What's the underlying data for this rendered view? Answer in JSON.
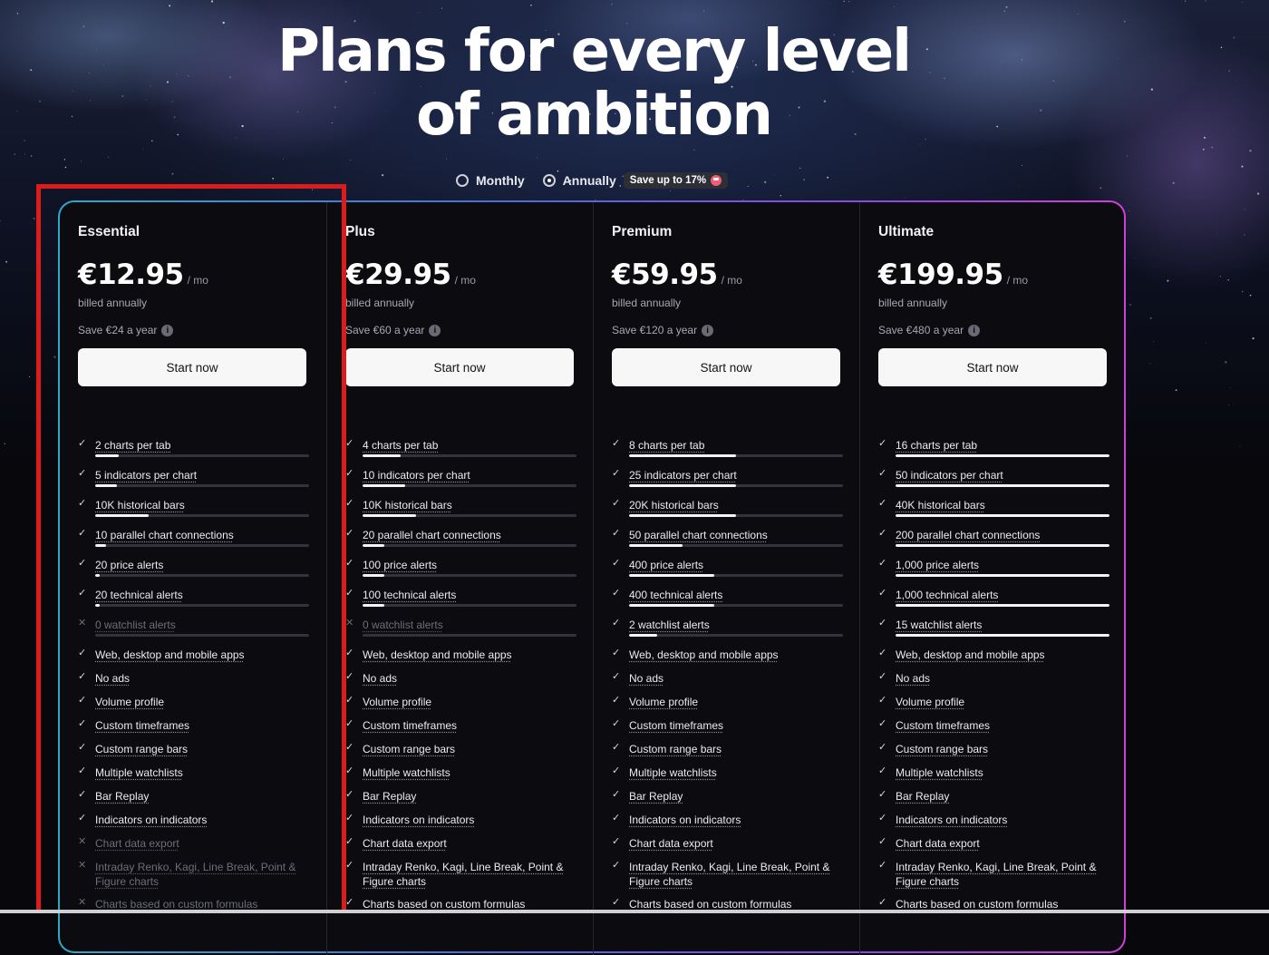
{
  "hero": {
    "title_line1": "Plans for every level",
    "title_line2": "of ambition"
  },
  "billing": {
    "monthly_label": "Monthly",
    "annually_label": "Annually",
    "selected": "Annually",
    "save_pill": "Save up to 17%"
  },
  "plans": [
    {
      "name": "Essential",
      "price": "€12.95",
      "per": "/ mo",
      "billed": "billed annually",
      "save": "Save €24 a year",
      "cta": "Start now",
      "metrics": [
        {
          "label": "2 charts per tab",
          "fraction": 0.11,
          "included": true
        },
        {
          "label": "5 indicators per chart",
          "fraction": 0.1,
          "included": true
        },
        {
          "label": "10K historical bars",
          "fraction": 0.25,
          "included": true
        },
        {
          "label": "10 parallel chart connections",
          "fraction": 0.05,
          "included": true
        },
        {
          "label": "20 price alerts",
          "fraction": 0.02,
          "included": true
        },
        {
          "label": "20 technical alerts",
          "fraction": 0.02,
          "included": true
        },
        {
          "label": "0 watchlist alerts",
          "fraction": 0,
          "included": false
        }
      ],
      "features": [
        {
          "label": "Web, desktop and mobile apps",
          "included": true
        },
        {
          "label": "No ads",
          "included": true
        },
        {
          "label": "Volume profile",
          "included": true
        },
        {
          "label": "Custom timeframes",
          "included": true
        },
        {
          "label": "Custom range bars",
          "included": true
        },
        {
          "label": "Multiple watchlists",
          "included": true
        },
        {
          "label": "Bar Replay",
          "included": true
        },
        {
          "label": "Indicators on indicators",
          "included": true
        },
        {
          "label": "Chart data export",
          "included": false
        },
        {
          "label": "Intraday Renko, Kagi, Line Break, Point & Figure charts",
          "included": false
        },
        {
          "label": "Charts based on custom formulas",
          "included": false
        }
      ]
    },
    {
      "name": "Plus",
      "price": "€29.95",
      "per": "/ mo",
      "billed": "billed annually",
      "save": "Save €60 a year",
      "cta": "Start now",
      "metrics": [
        {
          "label": "4 charts per tab",
          "fraction": 0.18,
          "included": true
        },
        {
          "label": "10 indicators per chart",
          "fraction": 0.2,
          "included": true
        },
        {
          "label": "10K historical bars",
          "fraction": 0.25,
          "included": true
        },
        {
          "label": "20 parallel chart connections",
          "fraction": 0.1,
          "included": true
        },
        {
          "label": "100 price alerts",
          "fraction": 0.1,
          "included": true
        },
        {
          "label": "100 technical alerts",
          "fraction": 0.1,
          "included": true
        },
        {
          "label": "0 watchlist alerts",
          "fraction": 0,
          "included": false
        }
      ],
      "features": [
        {
          "label": "Web, desktop and mobile apps",
          "included": true
        },
        {
          "label": "No ads",
          "included": true
        },
        {
          "label": "Volume profile",
          "included": true
        },
        {
          "label": "Custom timeframes",
          "included": true
        },
        {
          "label": "Custom range bars",
          "included": true
        },
        {
          "label": "Multiple watchlists",
          "included": true
        },
        {
          "label": "Bar Replay",
          "included": true
        },
        {
          "label": "Indicators on indicators",
          "included": true
        },
        {
          "label": "Chart data export",
          "included": true
        },
        {
          "label": "Intraday Renko, Kagi, Line Break, Point & Figure charts",
          "included": true
        },
        {
          "label": "Charts based on custom formulas",
          "included": true
        }
      ]
    },
    {
      "name": "Premium",
      "price": "€59.95",
      "per": "/ mo",
      "billed": "billed annually",
      "save": "Save €120 a year",
      "cta": "Start now",
      "metrics": [
        {
          "label": "8 charts per tab",
          "fraction": 0.5,
          "included": true
        },
        {
          "label": "25 indicators per chart",
          "fraction": 0.5,
          "included": true
        },
        {
          "label": "20K historical bars",
          "fraction": 0.5,
          "included": true
        },
        {
          "label": "50 parallel chart connections",
          "fraction": 0.25,
          "included": true
        },
        {
          "label": "400 price alerts",
          "fraction": 0.4,
          "included": true
        },
        {
          "label": "400 technical alerts",
          "fraction": 0.4,
          "included": true
        },
        {
          "label": "2 watchlist alerts",
          "fraction": 0.13,
          "included": true
        }
      ],
      "features": [
        {
          "label": "Web, desktop and mobile apps",
          "included": true
        },
        {
          "label": "No ads",
          "included": true
        },
        {
          "label": "Volume profile",
          "included": true
        },
        {
          "label": "Custom timeframes",
          "included": true
        },
        {
          "label": "Custom range bars",
          "included": true
        },
        {
          "label": "Multiple watchlists",
          "included": true
        },
        {
          "label": "Bar Replay",
          "included": true
        },
        {
          "label": "Indicators on indicators",
          "included": true
        },
        {
          "label": "Chart data export",
          "included": true
        },
        {
          "label": "Intraday Renko, Kagi, Line Break, Point & Figure charts",
          "included": true
        },
        {
          "label": "Charts based on custom formulas",
          "included": true
        }
      ]
    },
    {
      "name": "Ultimate",
      "price": "€199.95",
      "per": "/ mo",
      "billed": "billed annually",
      "save": "Save €480 a year",
      "cta": "Start now",
      "metrics": [
        {
          "label": "16 charts per tab",
          "fraction": 1,
          "included": true
        },
        {
          "label": "50 indicators per chart",
          "fraction": 1,
          "included": true
        },
        {
          "label": "40K historical bars",
          "fraction": 1,
          "included": true
        },
        {
          "label": "200 parallel chart connections",
          "fraction": 1,
          "included": true
        },
        {
          "label": "1,000 price alerts",
          "fraction": 1,
          "included": true
        },
        {
          "label": "1,000 technical alerts",
          "fraction": 1,
          "included": true
        },
        {
          "label": "15 watchlist alerts",
          "fraction": 1,
          "included": true
        }
      ],
      "features": [
        {
          "label": "Web, desktop and mobile apps",
          "included": true
        },
        {
          "label": "No ads",
          "included": true
        },
        {
          "label": "Volume profile",
          "included": true
        },
        {
          "label": "Custom timeframes",
          "included": true
        },
        {
          "label": "Custom range bars",
          "included": true
        },
        {
          "label": "Multiple watchlists",
          "included": true
        },
        {
          "label": "Bar Replay",
          "included": true
        },
        {
          "label": "Indicators on indicators",
          "included": true
        },
        {
          "label": "Chart data export",
          "included": true
        },
        {
          "label": "Intraday Renko, Kagi, Line Break, Point & Figure charts",
          "included": true
        },
        {
          "label": "Charts based on custom formulas",
          "included": true
        }
      ]
    }
  ],
  "icons": {
    "check": "check-icon",
    "cross": "cross-icon",
    "info": "info-icon"
  },
  "colors": {
    "highlight": "#dc1c1c",
    "border_start": "#2fa8c8",
    "border_end": "#d040d8"
  }
}
